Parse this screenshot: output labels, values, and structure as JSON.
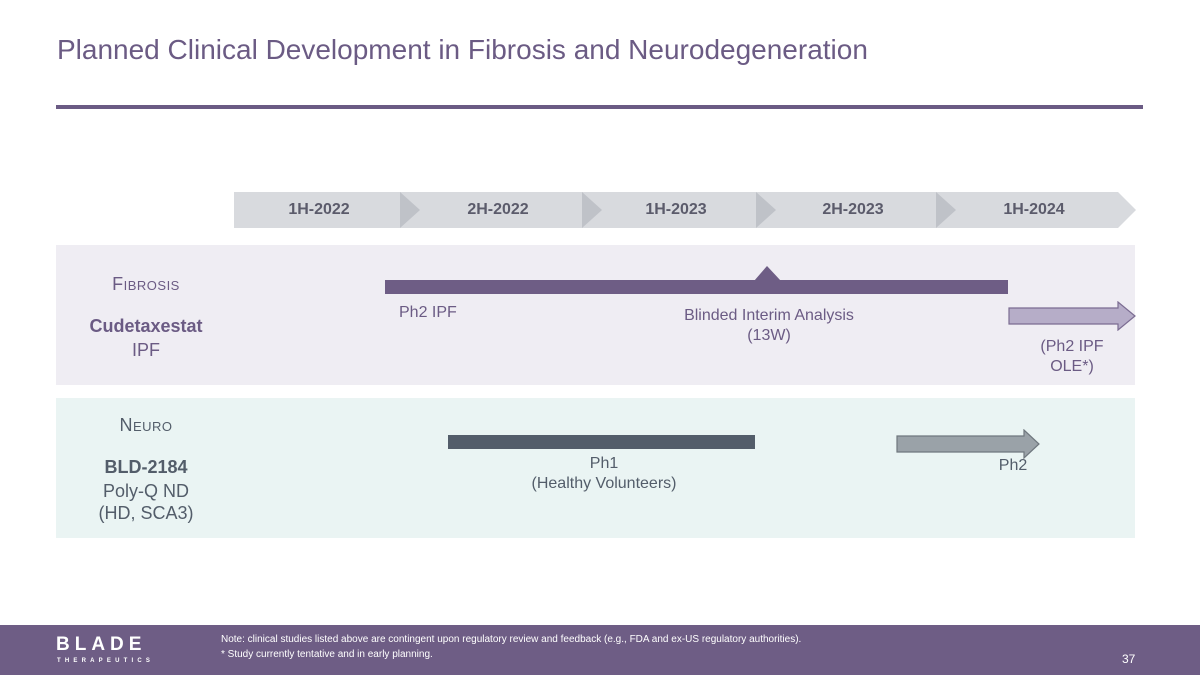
{
  "title": "Planned Clinical Development in Fibrosis and Neurodegeneration",
  "timeline": {
    "periods": [
      "1H-2022",
      "2H-2022",
      "1H-2023",
      "2H-2023",
      "1H-2024"
    ]
  },
  "fibrosis": {
    "area": "Fibrosis",
    "drug": "Cudetaxestat",
    "indication": "IPF",
    "bar_label": "Ph2 IPF",
    "milestone_label": [
      "Blinded Interim Analysis",
      "(13W)"
    ],
    "arrow_label": [
      "(Ph2 IPF",
      "OLE*)"
    ]
  },
  "neuro": {
    "area": "Neuro",
    "drug": "BLD-2184",
    "indication": [
      "Poly-Q ND",
      "(HD, SCA3)"
    ],
    "bar_label": [
      "Ph1",
      "(Healthy Volunteers)"
    ],
    "arrow_label": "Ph2"
  },
  "footer": {
    "logo": "BLADE",
    "logo_sub": "THERAPEUTICS",
    "note": "Note: clinical studies listed above are contingent upon regulatory review and feedback (e.g., FDA and ex-US regulatory authorities).",
    "footnote": "* Study currently tentative and in early planning.",
    "page_number": "37"
  },
  "colors": {
    "title": "#6b5b84",
    "timeline_fill": "#d8dade",
    "timeline_separator": "#bfc2c8",
    "fibrosis_bar": "#6e5d85",
    "fibrosis_arrow": "#b6adc8",
    "neuro_bar": "#535d6a",
    "neuro_arrow": "#9aa2a8",
    "fibrosis_band": "#efedf3",
    "neuro_band": "#eaf4f3",
    "footer": "#6e5d85"
  }
}
